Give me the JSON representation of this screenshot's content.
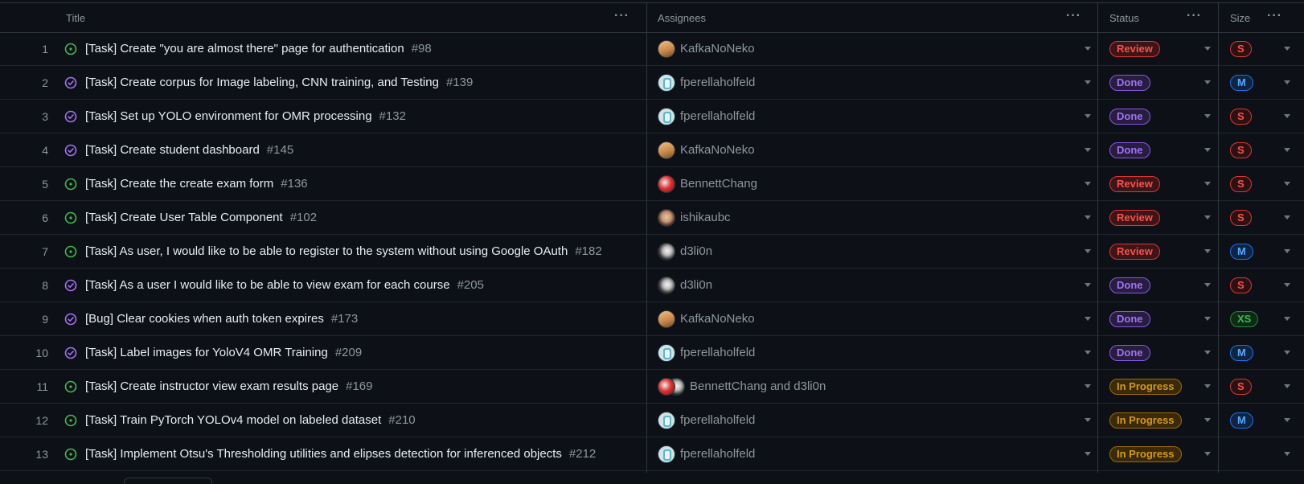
{
  "columns": {
    "title": "Title",
    "assignees": "Assignees",
    "status": "Status",
    "size": "Size",
    "menu_glyph": "···"
  },
  "status_styles": {
    "Review": {
      "color": "#f85149",
      "bg": "#3d1418",
      "border": "#da3633"
    },
    "Done": {
      "color": "#a371f7",
      "bg": "#271d3e",
      "border": "#8957e5"
    },
    "In Progress": {
      "color": "#d29922",
      "bg": "#3a2a0a",
      "border": "#9e6a03"
    }
  },
  "size_styles": {
    "S": {
      "color": "#f85149",
      "bg": "#2b1113",
      "border": "#da3633"
    },
    "M": {
      "color": "#58a6ff",
      "bg": "#0f2440",
      "border": "#1f6feb"
    },
    "XS": {
      "color": "#3fb950",
      "bg": "#0f2b18",
      "border": "#238636"
    }
  },
  "issue_icon_colors": {
    "open": "#3fb950",
    "closed": "#a371f7"
  },
  "rows": [
    {
      "num": "1",
      "state": "open",
      "title": "[Task] Create \"you are almost there\" page for authentication",
      "issue": "#98",
      "assignees": "KafkaNoNeko",
      "avatars": [
        "kafka"
      ],
      "status": "Review",
      "size": "S"
    },
    {
      "num": "2",
      "state": "closed",
      "title": "[Task] Create corpus for Image labeling, CNN training, and Testing",
      "issue": "#139",
      "assignees": "fperellaholfeld",
      "avatars": [
        "fperella"
      ],
      "status": "Done",
      "size": "M"
    },
    {
      "num": "3",
      "state": "closed",
      "title": "[Task] Set up YOLO environment for OMR processing",
      "issue": "#132",
      "assignees": "fperellaholfeld",
      "avatars": [
        "fperella"
      ],
      "status": "Done",
      "size": "S"
    },
    {
      "num": "4",
      "state": "closed",
      "title": "[Task] Create student dashboard",
      "issue": "#145",
      "assignees": "KafkaNoNeko",
      "avatars": [
        "kafka"
      ],
      "status": "Done",
      "size": "S"
    },
    {
      "num": "5",
      "state": "open",
      "title": "[Task] Create the create exam form",
      "issue": "#136",
      "assignees": "BennettChang",
      "avatars": [
        "bennett"
      ],
      "status": "Review",
      "size": "S"
    },
    {
      "num": "6",
      "state": "open",
      "title": "[Task] Create User Table Component",
      "issue": "#102",
      "assignees": "ishikaubc",
      "avatars": [
        "ishika"
      ],
      "status": "Review",
      "size": "S"
    },
    {
      "num": "7",
      "state": "open",
      "title": "[Task] As user, I would like to be able to register to the system without using Google OAuth",
      "issue": "#182",
      "assignees": "d3li0n",
      "avatars": [
        "d3li0n"
      ],
      "status": "Review",
      "size": "M"
    },
    {
      "num": "8",
      "state": "closed",
      "title": "[Task] As a user I would like to be able to view exam for each course",
      "issue": "#205",
      "assignees": "d3li0n",
      "avatars": [
        "d3li0n"
      ],
      "status": "Done",
      "size": "S"
    },
    {
      "num": "9",
      "state": "closed",
      "title": "[Bug] Clear cookies when auth token expires",
      "issue": "#173",
      "assignees": "KafkaNoNeko",
      "avatars": [
        "kafka"
      ],
      "status": "Done",
      "size": "XS"
    },
    {
      "num": "10",
      "state": "closed",
      "title": "[Task] Label images for YoloV4 OMR Training",
      "issue": "#209",
      "assignees": "fperellaholfeld",
      "avatars": [
        "fperella"
      ],
      "status": "Done",
      "size": "M"
    },
    {
      "num": "11",
      "state": "open",
      "title": "[Task] Create instructor view exam results page",
      "issue": "#169",
      "assignees": "BennettChang and d3li0n",
      "avatars": [
        "bennett",
        "d3li0n"
      ],
      "status": "In Progress",
      "size": "S"
    },
    {
      "num": "12",
      "state": "open",
      "title": "[Task] Train PyTorch YOLOv4 model on labeled dataset",
      "issue": "#210",
      "assignees": "fperellaholfeld",
      "avatars": [
        "fperella"
      ],
      "status": "In Progress",
      "size": "M"
    },
    {
      "num": "13",
      "state": "open",
      "title": "[Task] Implement Otsu's Thresholding utilities and elipses detection for inferenced objects",
      "issue": "#212",
      "assignees": "fperellaholfeld",
      "avatars": [
        "fperella"
      ],
      "status": "In Progress",
      "size": ""
    }
  ]
}
